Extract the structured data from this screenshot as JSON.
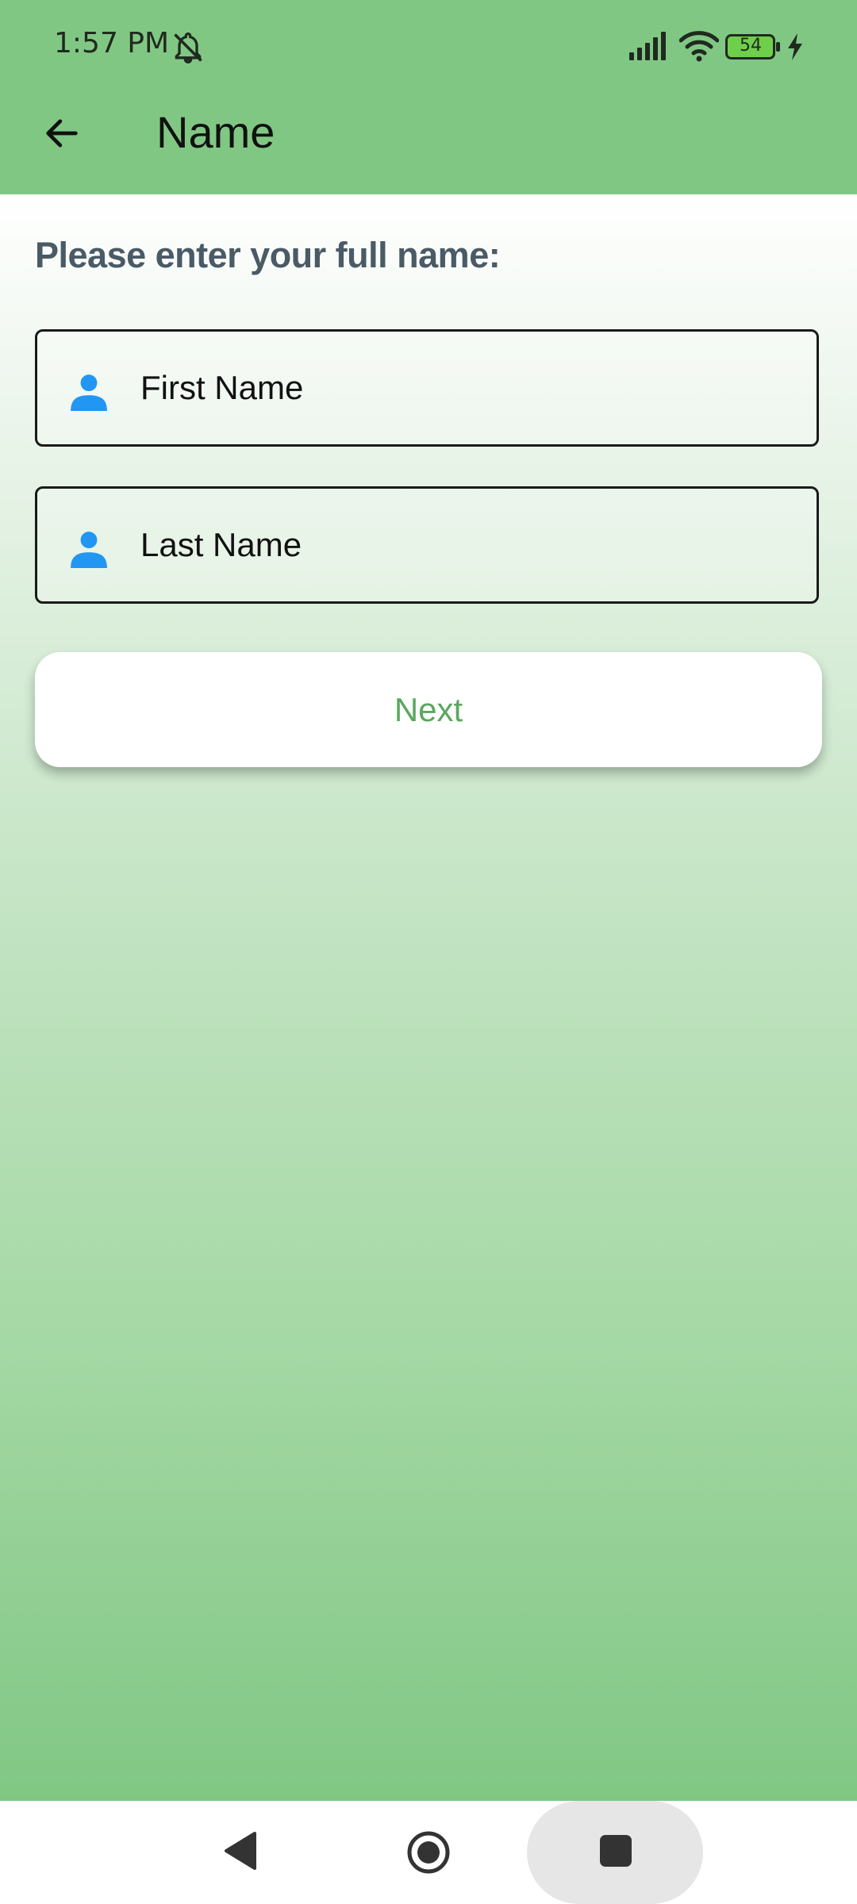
{
  "status_bar": {
    "time": "1:57 PM",
    "battery_level": "54",
    "icons": [
      "bell-off-icon",
      "signal-icon",
      "wifi-icon",
      "battery-icon",
      "charging-bolt-icon"
    ]
  },
  "app_bar": {
    "title": "Name",
    "back_icon": "arrow-left-icon"
  },
  "form": {
    "prompt": "Please enter your full name:",
    "first_name": {
      "value": "",
      "placeholder": "First Name",
      "icon": "person-icon"
    },
    "last_name": {
      "value": "",
      "placeholder": "Last Name",
      "icon": "person-icon"
    },
    "next_label": "Next"
  },
  "nav_bar": {
    "icons": [
      "nav-back-icon",
      "nav-home-icon",
      "nav-recents-icon"
    ]
  },
  "colors": {
    "app_bar": "#81c784",
    "prompt_text": "#4a5a66",
    "field_icon": "#2196f3",
    "next_text": "#5aa85e"
  }
}
